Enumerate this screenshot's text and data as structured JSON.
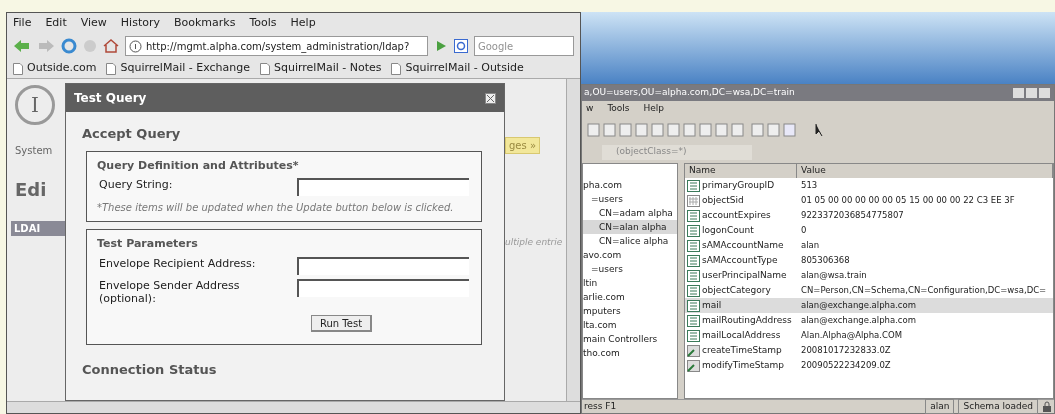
{
  "browser": {
    "menu": [
      "File",
      "Edit",
      "View",
      "History",
      "Bookmarks",
      "Tools",
      "Help"
    ],
    "url": "http://mgmt.alpha.com/system_administration/ldap?",
    "search": {
      "placeholder": "Google"
    },
    "bookmarks": [
      "Outside.com",
      "SquirrelMail - Exchange",
      "SquirrelMail - Notes",
      "SquirrelMail - Outside"
    ],
    "page": {
      "logo": "I",
      "left_texts": [
        "System",
        "Edi"
      ],
      "header_fragment": "LDAI",
      "button_fragment": "ges »",
      "note_fragment": "ultiple entrie"
    }
  },
  "dialog": {
    "title": "Test Query",
    "heading": "Accept Query",
    "sections": [
      {
        "title": "Query Definition and Attributes*",
        "fields": [
          {
            "label": "Query String:"
          }
        ],
        "note": "*These items will be updated when the Update button below is clicked."
      },
      {
        "title": "Test Parameters",
        "fields": [
          {
            "label": "Envelope Recipient Address:"
          },
          {
            "label": "Envelope Sender Address (optional):"
          }
        ],
        "button": "Run Test"
      }
    ],
    "footer_heading": "Connection Status"
  },
  "ldap": {
    "title": "a,OU=users,OU=alpha.com,DC=wsa,DC=train",
    "menu": [
      "w",
      "Tools",
      "Help"
    ],
    "filter": "(objectClass=*)",
    "tree": [
      {
        "label": "pha.com",
        "selected": false,
        "children": [
          {
            "label": "=users",
            "selected": false,
            "children": [
              {
                "label": "CN=adam alpha",
                "selected": false
              },
              {
                "label": "CN=alan alpha",
                "selected": true
              },
              {
                "label": "CN=alice alpha",
                "selected": false
              }
            ]
          }
        ]
      },
      {
        "label": "avo.com",
        "selected": false,
        "children": [
          {
            "label": "=users",
            "selected": false
          }
        ]
      },
      {
        "label": "ltin",
        "selected": false
      },
      {
        "label": "arlie.com",
        "selected": false
      },
      {
        "label": "mputers",
        "selected": false
      },
      {
        "label": "lta.com",
        "selected": false
      },
      {
        "label": "main Controllers",
        "selected": false
      },
      {
        "label": "tho.com",
        "selected": false
      }
    ],
    "columns": [
      "Name",
      "Value"
    ],
    "rows": [
      {
        "kind": "text",
        "name": "primaryGroupID",
        "value": "513",
        "selected": false
      },
      {
        "kind": "binary",
        "name": "objectSid",
        "value": "01 05 00 00 00 00 00 05 15 00 00 00 22 C3 EE 3F",
        "selected": false
      },
      {
        "kind": "text",
        "name": "accountExpires",
        "value": "9223372036854775807",
        "selected": false
      },
      {
        "kind": "text",
        "name": "logonCount",
        "value": "0",
        "selected": false
      },
      {
        "kind": "text",
        "name": "sAMAccountName",
        "value": "alan",
        "selected": false
      },
      {
        "kind": "text",
        "name": "sAMAccountType",
        "value": "805306368",
        "selected": false
      },
      {
        "kind": "text",
        "name": "userPrincipalName",
        "value": "alan@wsa.train",
        "selected": false
      },
      {
        "kind": "text",
        "name": "objectCategory",
        "value": "CN=Person,CN=Schema,CN=Configuration,DC=wsa,DC=",
        "selected": false
      },
      {
        "kind": "text",
        "name": "mail",
        "value": "alan@exchange.alpha.com",
        "selected": true
      },
      {
        "kind": "text",
        "name": "mailRoutingAddress",
        "value": "alan@exchange.alpha.com",
        "selected": false
      },
      {
        "kind": "text",
        "name": "mailLocalAddress",
        "value": "Alan.Alpha@Alpha.COM",
        "selected": false
      },
      {
        "kind": "time",
        "name": "createTimeStamp",
        "value": "20081017232833.0Z",
        "selected": false
      },
      {
        "kind": "time",
        "name": "modifyTimeStamp",
        "value": "20090522234209.0Z",
        "selected": false
      }
    ],
    "status": {
      "help": "ress F1",
      "user": "alan",
      "schema": "Schema loaded"
    }
  }
}
